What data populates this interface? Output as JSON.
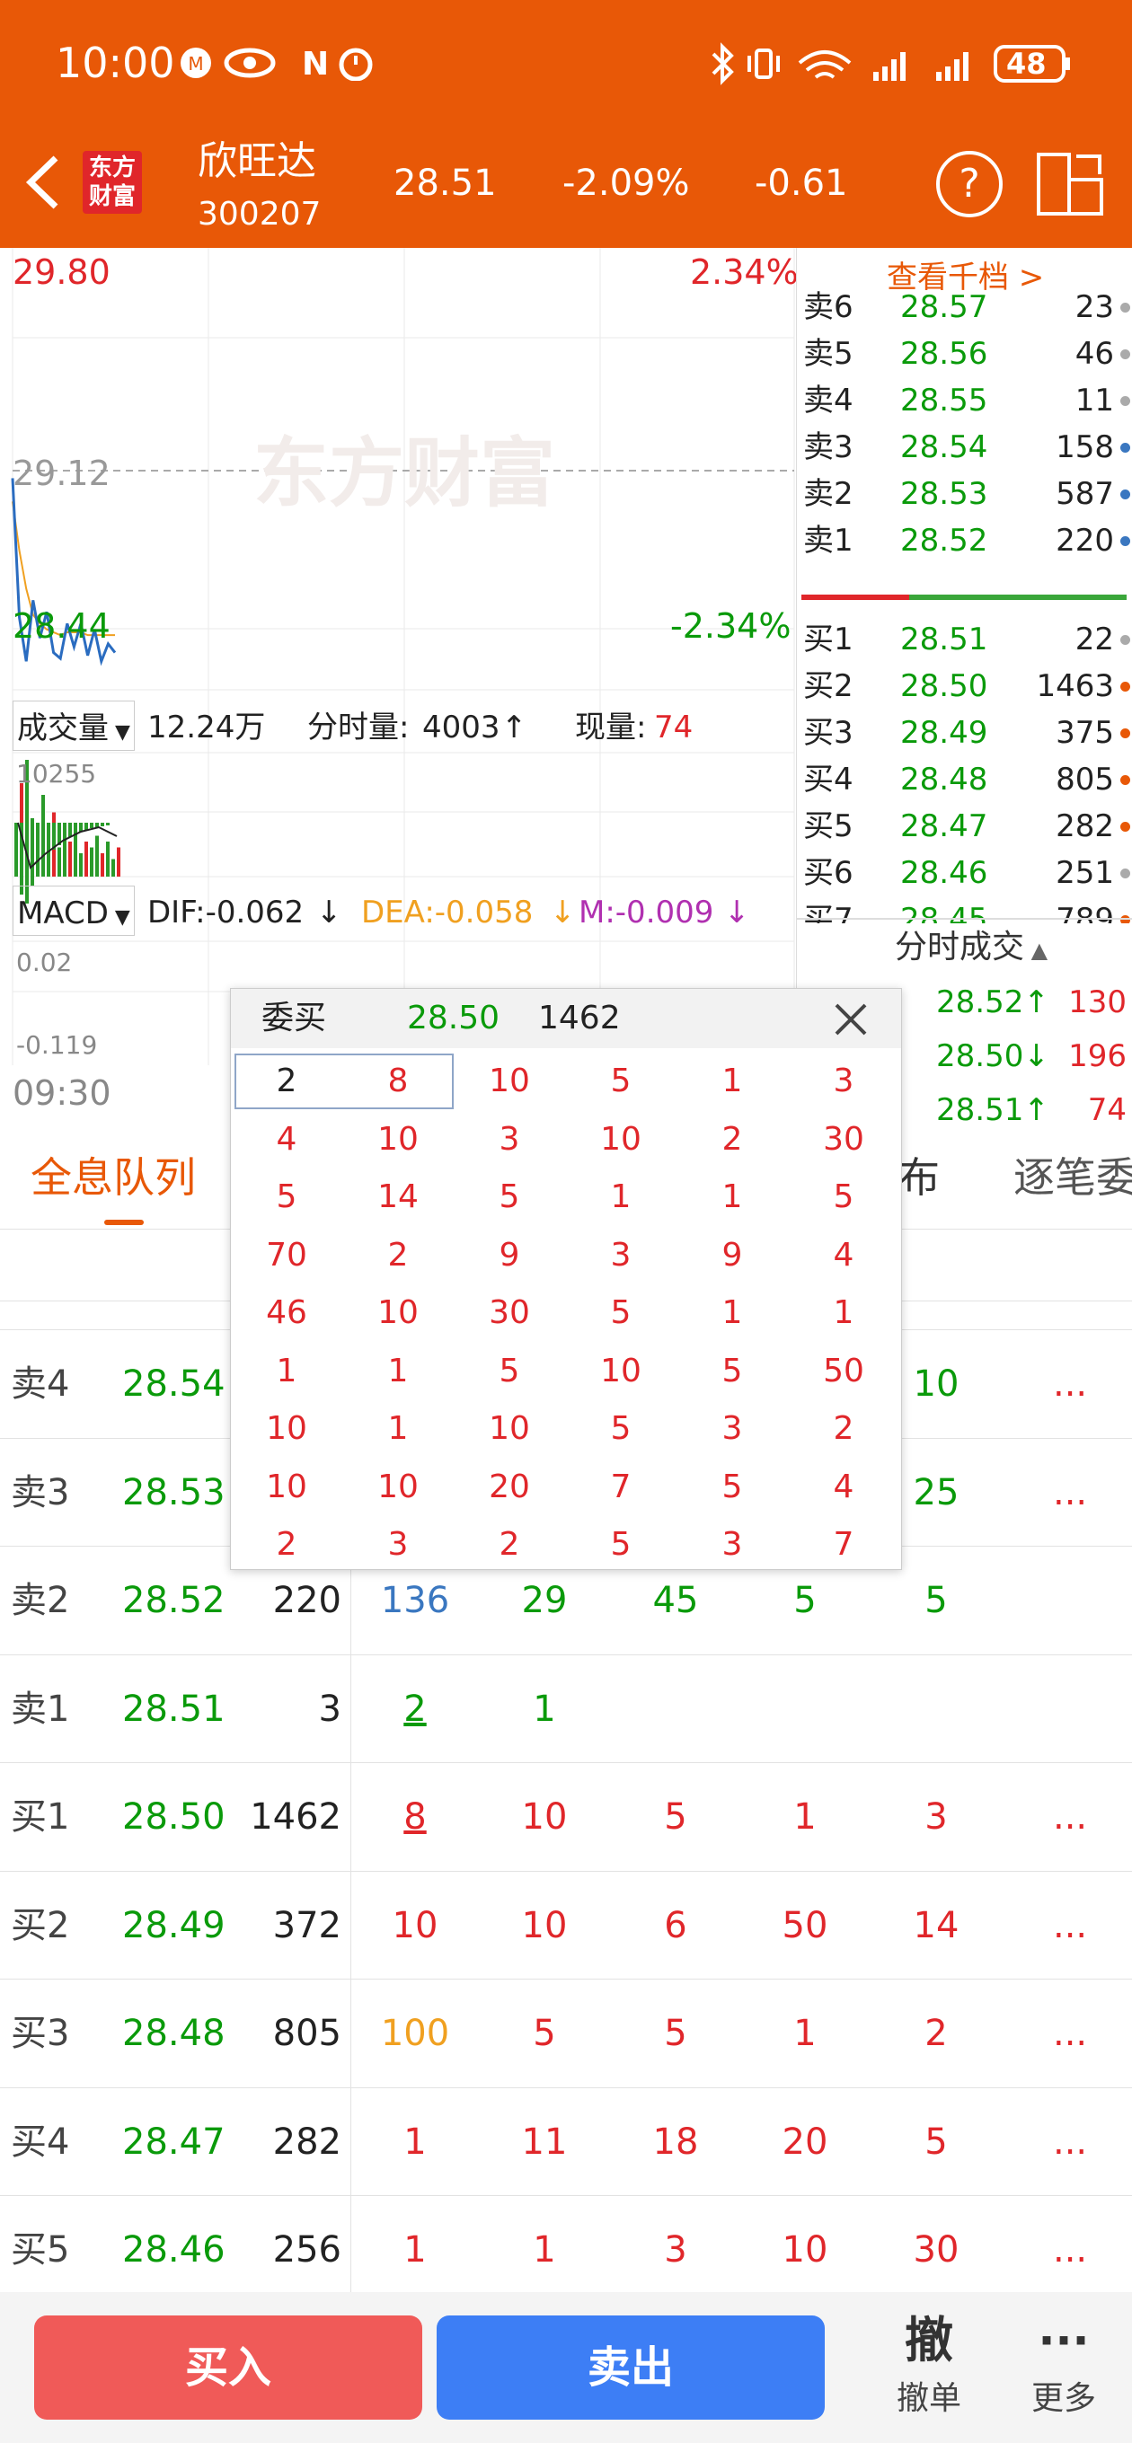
{
  "status_bar": {
    "time": "10:00",
    "battery": "48",
    "left_icons": [
      "china-mobile-icon",
      "eye-icon",
      "nfc-icon",
      "alarm-icon"
    ],
    "right_icons": [
      "bluetooth-icon",
      "vibrate-icon",
      "wifi-icon",
      "signal-icon",
      "signal-icon"
    ]
  },
  "header": {
    "logo_line1": "东方",
    "logo_line2": "财富",
    "name": "欣旺达",
    "code": "300207",
    "price": "28.51",
    "change_pct": "-2.09%",
    "change": "-0.61",
    "help": "?"
  },
  "chart": {
    "high": "29.80",
    "high_pct": "2.34%",
    "mid": "29.12",
    "low": "28.44",
    "low_pct": "-2.34%",
    "watermark": "东方财富",
    "start_time": "09:30",
    "price_line": [
      29.1,
      28.62,
      28.47,
      28.68,
      28.55,
      28.64,
      28.5,
      28.48,
      28.6,
      28.52,
      28.6,
      28.49,
      28.58,
      28.47,
      28.53,
      28.5
    ],
    "avg_line": [
      29.02,
      28.85,
      28.72,
      28.63,
      28.6,
      28.58,
      28.57,
      28.56,
      28.57,
      28.57,
      28.57,
      28.56,
      28.56,
      28.56,
      28.56,
      28.56
    ]
  },
  "volume": {
    "selector": "成交量",
    "total": "12.24万",
    "fenshi_label": "分时量:",
    "fenshi_value": "4003",
    "now_label": "现量:",
    "now_value": "74",
    "max": "10255",
    "bars": [
      0.4,
      0.8,
      1.0,
      0.5,
      0.3,
      0.7,
      0.35,
      0.55,
      0.25,
      0.4,
      0.3,
      0.45,
      0.2,
      0.3,
      0.25,
      0.35,
      0.2,
      0.3,
      0.15,
      0.25
    ]
  },
  "macd": {
    "selector": "MACD",
    "dif": "DIF:-0.062",
    "dea": "DEA:-0.058",
    "m": "M:-0.009",
    "top": "0.02",
    "bottom": "-0.119"
  },
  "order_book": {
    "link": "查看千档 >",
    "asks": [
      {
        "label": "卖6",
        "price": "28.57",
        "vol": "23"
      },
      {
        "label": "卖5",
        "price": "28.56",
        "vol": "46"
      },
      {
        "label": "卖4",
        "price": "28.55",
        "vol": "11"
      },
      {
        "label": "卖3",
        "price": "28.54",
        "vol": "158"
      },
      {
        "label": "卖2",
        "price": "28.53",
        "vol": "587"
      },
      {
        "label": "卖1",
        "price": "28.52",
        "vol": "220"
      }
    ],
    "bids": [
      {
        "label": "买1",
        "price": "28.51",
        "vol": "22"
      },
      {
        "label": "买2",
        "price": "28.50",
        "vol": "1463"
      },
      {
        "label": "买3",
        "price": "28.49",
        "vol": "375"
      },
      {
        "label": "买4",
        "price": "28.48",
        "vol": "805"
      },
      {
        "label": "买5",
        "price": "28.47",
        "vol": "282"
      },
      {
        "label": "买6",
        "price": "28.46",
        "vol": "251"
      },
      {
        "label": "买7",
        "price": "28.45",
        "vol": "789"
      }
    ],
    "trades_title": "分时成交",
    "trades": [
      {
        "price": "28.52↑",
        "vol": "130"
      },
      {
        "price": "28.50↓",
        "vol": "196"
      },
      {
        "price": "28.51↑",
        "vol": "74"
      }
    ]
  },
  "tabs": {
    "t1": "全息队列",
    "t2": "布",
    "t3": "逐笔委"
  },
  "queue_rows": [
    {
      "label": "卖4",
      "price": "28.54",
      "total": "",
      "cells": [
        "",
        "",
        "",
        "",
        "10"
      ],
      "more": "..."
    },
    {
      "label": "卖3",
      "price": "28.53",
      "total": "",
      "cells": [
        "",
        "",
        "",
        "",
        "25"
      ],
      "more": "..."
    },
    {
      "label": "卖2",
      "price": "28.52",
      "total": "220",
      "cells": [
        "136",
        "29",
        "45",
        "5",
        "5"
      ],
      "more": ""
    },
    {
      "label": "卖1",
      "price": "28.51",
      "total": "3",
      "cells": [
        "2",
        "1",
        "",
        "",
        ""
      ],
      "more": ""
    },
    {
      "label": "买1",
      "price": "28.50",
      "total": "1462",
      "cells": [
        "8",
        "10",
        "5",
        "1",
        "3"
      ],
      "more": "..."
    },
    {
      "label": "买2",
      "price": "28.49",
      "total": "372",
      "cells": [
        "10",
        "10",
        "6",
        "50",
        "14"
      ],
      "more": "..."
    },
    {
      "label": "买3",
      "price": "28.48",
      "total": "805",
      "cells": [
        "100",
        "5",
        "5",
        "1",
        "2"
      ],
      "more": "..."
    },
    {
      "label": "买4",
      "price": "28.47",
      "total": "282",
      "cells": [
        "1",
        "11",
        "18",
        "20",
        "5"
      ],
      "more": "..."
    },
    {
      "label": "买5",
      "price": "28.46",
      "total": "256",
      "cells": [
        "1",
        "1",
        "3",
        "10",
        "30"
      ],
      "more": "..."
    }
  ],
  "popup": {
    "title": "委买",
    "price": "28.50",
    "total": "1462",
    "grid": [
      [
        "2",
        "8",
        "10",
        "5",
        "1",
        "3"
      ],
      [
        "4",
        "10",
        "3",
        "10",
        "2",
        "30"
      ],
      [
        "5",
        "14",
        "5",
        "1",
        "1",
        "5"
      ],
      [
        "70",
        "2",
        "9",
        "3",
        "9",
        "4"
      ],
      [
        "46",
        "10",
        "30",
        "5",
        "1",
        "1"
      ],
      [
        "1",
        "1",
        "5",
        "10",
        "5",
        "50"
      ],
      [
        "10",
        "1",
        "10",
        "5",
        "3",
        "2"
      ],
      [
        "10",
        "10",
        "20",
        "7",
        "5",
        "4"
      ],
      [
        "2",
        "3",
        "2",
        "5",
        "3",
        "7"
      ]
    ]
  },
  "bottom": {
    "buy": "买入",
    "sell": "卖出",
    "cancel_icon": "撤",
    "cancel": "撤单",
    "more_icon": "···",
    "more": "更多"
  }
}
